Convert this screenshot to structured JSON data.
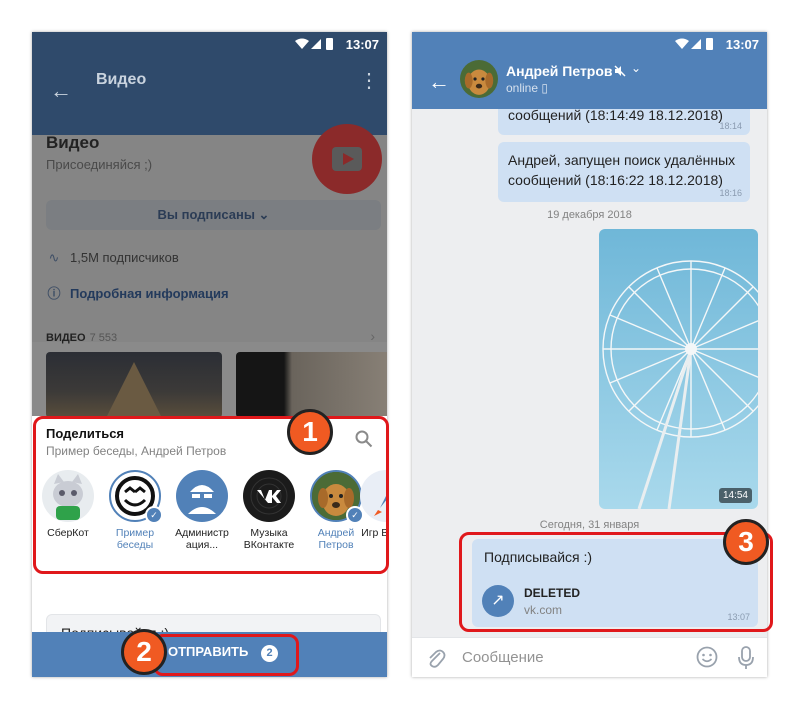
{
  "status_time": "13:07",
  "left": {
    "appbar_title": "Видео",
    "group": {
      "name": "Видео",
      "tagline": "Присоединяйся ;)",
      "subscribed_label": "Вы подписаны",
      "subscribers": "1,5M подписчиков",
      "more_info": "Подробная информация",
      "videos_heading": "ВИДЕО",
      "videos_count": "7 553"
    },
    "share": {
      "title": "Поделиться",
      "subtitle": "Пример беседы, Андрей Петров",
      "contacts": [
        {
          "label": "СберКот",
          "selected": false
        },
        {
          "label": "Пример беседы",
          "selected": true
        },
        {
          "label": "Администр ация...",
          "selected": false
        },
        {
          "label": "Музыка ВКонтакте",
          "selected": false
        },
        {
          "label": "Андрей Петров",
          "selected": true
        },
        {
          "label": "Игр ВКонт",
          "selected": false
        }
      ],
      "message": "Подписывайся :)",
      "send_label": "ОТПРАВИТЬ",
      "send_count": "2"
    }
  },
  "right": {
    "contact_name": "Андрей Петров",
    "contact_status": "online",
    "messages": [
      {
        "text": "сообщений (18:14:49 18.12.2018)",
        "time": "18:14"
      },
      {
        "text": "Андрей, запущен поиск удалённых сообщений (18:16:22 18.12.2018)",
        "time": "18:16"
      }
    ],
    "date_1": "19 декабря 2018",
    "photo_time": "14:54",
    "date_2": "Сегодня, 31 января",
    "link_message": {
      "text": "Подписывайся :)",
      "title": "DELETED",
      "domain": "vk.com",
      "time": "13:07"
    },
    "compose_placeholder": "Сообщение"
  },
  "callouts": [
    "1",
    "2",
    "3"
  ],
  "colors": {
    "vk_blue": "#5181b8",
    "bubble": "#cfe0f3",
    "callout_red": "#e0181b",
    "callout_orange": "#f05a22"
  }
}
